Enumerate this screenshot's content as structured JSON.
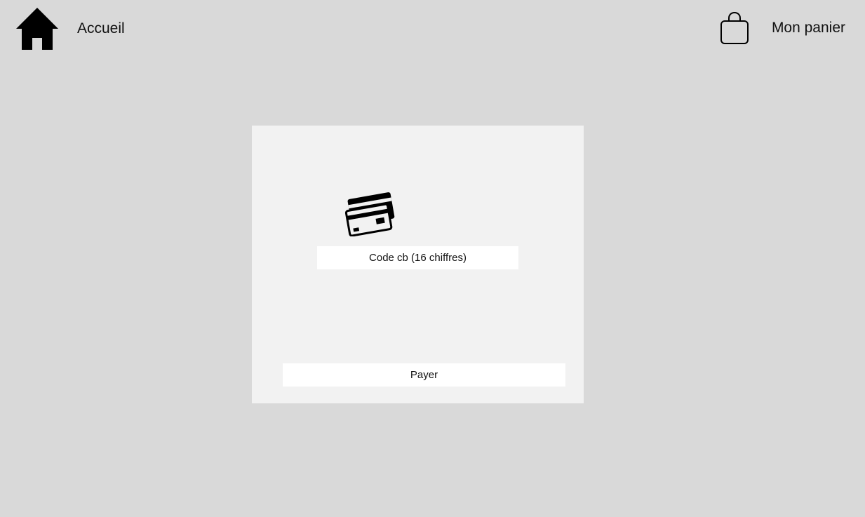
{
  "header": {
    "home_label": "Accueil",
    "home_icon": "home-icon",
    "cart_label": "Mon panier",
    "cart_icon": "shopping-bag-icon"
  },
  "payment": {
    "card_icon": "credit-cards-icon",
    "code_placeholder": "Code cb (16 chiffres)",
    "pay_label": "Payer"
  },
  "colors": {
    "background": "#d9d9d9",
    "panel": "#f2f2f2",
    "field": "#ffffff"
  }
}
